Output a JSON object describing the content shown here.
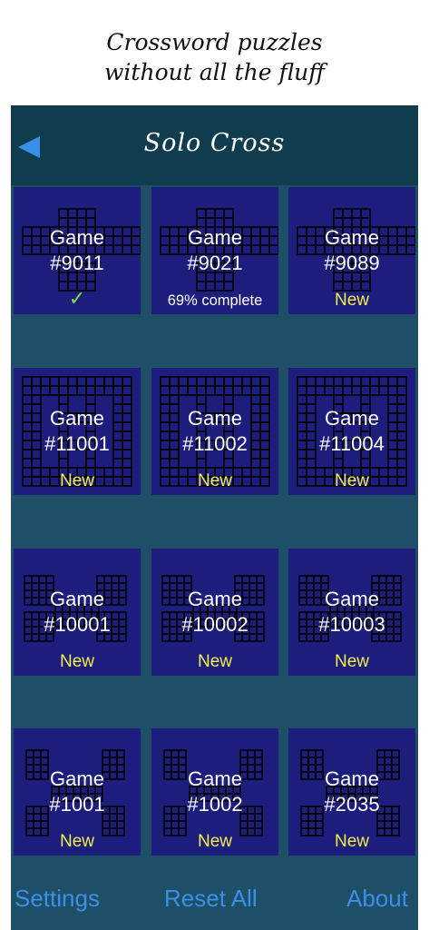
{
  "tagline": {
    "line1": "Crossword puzzles",
    "line2": "without all the fluff"
  },
  "header": {
    "title": "Solo Cross",
    "back_icon": "back-arrow-icon"
  },
  "games": [
    {
      "line1": "Game",
      "line2": "#9011",
      "status": "✓",
      "kind": "done"
    },
    {
      "line1": "Game",
      "line2": "#9021",
      "status": "69% complete",
      "kind": "progress"
    },
    {
      "line1": "Game",
      "line2": "#9089",
      "status": "New",
      "kind": "new"
    },
    {
      "line1": "Game",
      "line2": "#11001",
      "status": "New",
      "kind": "new"
    },
    {
      "line1": "Game",
      "line2": "#11002",
      "status": "New",
      "kind": "new"
    },
    {
      "line1": "Game",
      "line2": "#11004",
      "status": "New",
      "kind": "new"
    },
    {
      "line1": "Game",
      "line2": "#10001",
      "status": "New",
      "kind": "new"
    },
    {
      "line1": "Game",
      "line2": "#10002",
      "status": "New",
      "kind": "new"
    },
    {
      "line1": "Game",
      "line2": "#10003",
      "status": "New",
      "kind": "new"
    },
    {
      "line1": "Game",
      "line2": "#1001",
      "status": "New",
      "kind": "new"
    },
    {
      "line1": "Game",
      "line2": "#1002",
      "status": "New",
      "kind": "new"
    },
    {
      "line1": "Game",
      "line2": "#2035",
      "status": "New",
      "kind": "new"
    }
  ],
  "footer": {
    "settings": "Settings",
    "reset": "Reset All",
    "about": "About"
  },
  "colors": {
    "background": "#1f4f66",
    "header": "#103d4d",
    "tile": "#1c1d7d",
    "new": "#f2ee4a",
    "done": "#7ddc4f",
    "link": "#3a8fe8"
  }
}
